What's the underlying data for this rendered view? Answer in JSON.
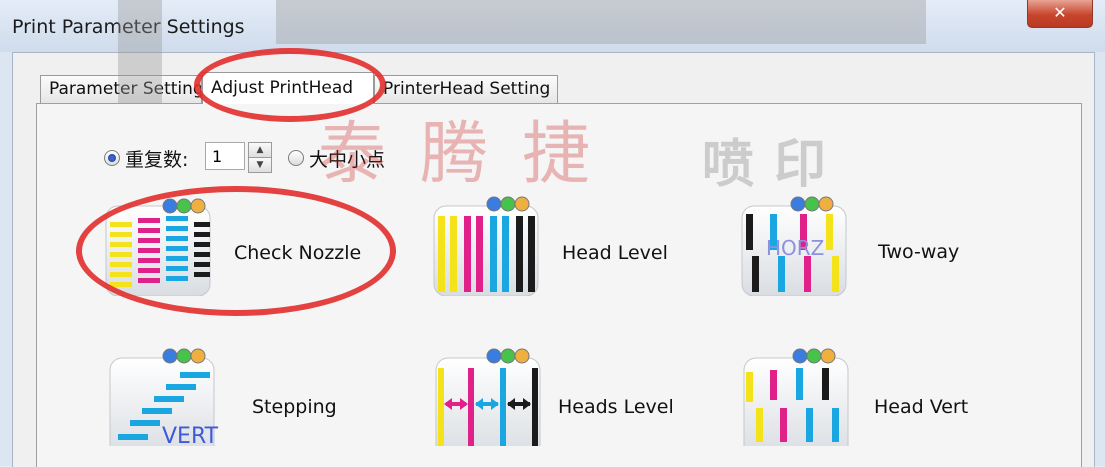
{
  "window": {
    "title": "Print Parameter Settings",
    "close_glyph": "✕"
  },
  "tabs": [
    {
      "label": "Parameter Setting",
      "active": false
    },
    {
      "label": "Adjust PrintHead",
      "active": true
    },
    {
      "label": "PrinterHead Setting",
      "active": false
    }
  ],
  "options": {
    "repeat_label": "重复数:",
    "repeat_value": "1",
    "dot_size_label": "大中小点",
    "repeat_selected": true
  },
  "tools": [
    {
      "label": "Check Nozzle",
      "icon": "check-nozzle-icon"
    },
    {
      "label": "Head Level",
      "icon": "head-level-icon"
    },
    {
      "label": "Two-way",
      "icon": "two-way-icon",
      "icon_text": "HORZ"
    },
    {
      "label": "Stepping",
      "icon": "stepping-icon",
      "icon_text": "VERT"
    },
    {
      "label": "Heads Level",
      "icon": "heads-level-icon"
    },
    {
      "label": "Head Vert",
      "icon": "head-vert-icon"
    }
  ],
  "watermark": {
    "brand_cn": "泰腾捷",
    "suffix_cn": "喷印"
  },
  "colors": {
    "cyan": "#1aa6e0",
    "magenta": "#e0218a",
    "yellow": "#f4e31a",
    "black": "#1b1b1b",
    "annotation": "#e22d2d"
  }
}
